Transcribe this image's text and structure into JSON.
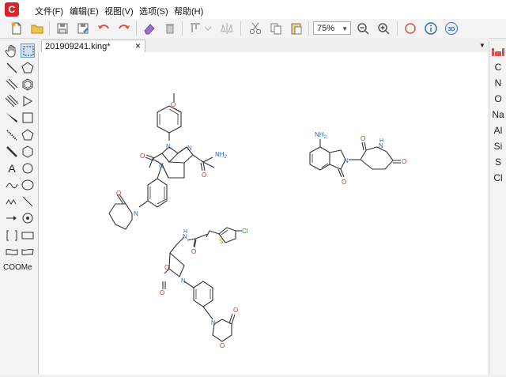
{
  "menu": {
    "file": "文件(F)",
    "edit": "编辑(E)",
    "view": "视图(V)",
    "options": "选项(S)",
    "help": "帮助(H)"
  },
  "toolbar": {
    "zoom_value": "75%",
    "view3d_label": "3D"
  },
  "left_palette": {
    "text_tool_label": "A",
    "functional_group_label": "COOMe"
  },
  "document": {
    "tab_title": "201909241.king*",
    "close_glyph": "×"
  },
  "right_palette": {
    "elements": [
      "C",
      "N",
      "O",
      "Na",
      "Al",
      "Si",
      "S",
      "Cl"
    ]
  },
  "molecules": {
    "apixaban": {
      "methoxy_o": "O",
      "n1": "N",
      "n2": "N",
      "n_lactam": "N",
      "n_piperidinone": "N",
      "o_lactam": "O",
      "o_piperidinone": "O",
      "o_amide": "O",
      "nh2": "NH",
      "nh2_sub": "2"
    },
    "lenalidomide": {
      "nh2": "NH",
      "nh2_sub": "2",
      "n_isoindolinone": "N",
      "nh": "N",
      "h": "H",
      "o1": "O",
      "o2": "O",
      "o3": "O"
    },
    "rivaroxaban": {
      "cl": "Cl",
      "s": "S",
      "nh": "N",
      "h": "H",
      "o_amide": "O",
      "o_ring": "O",
      "o_carbonyl": "O",
      "n_oxazolidinone": "N",
      "n_morpholinone": "N",
      "o_morpholinone_carbonyl": "O",
      "o_morpholinone_ring": "O"
    }
  }
}
